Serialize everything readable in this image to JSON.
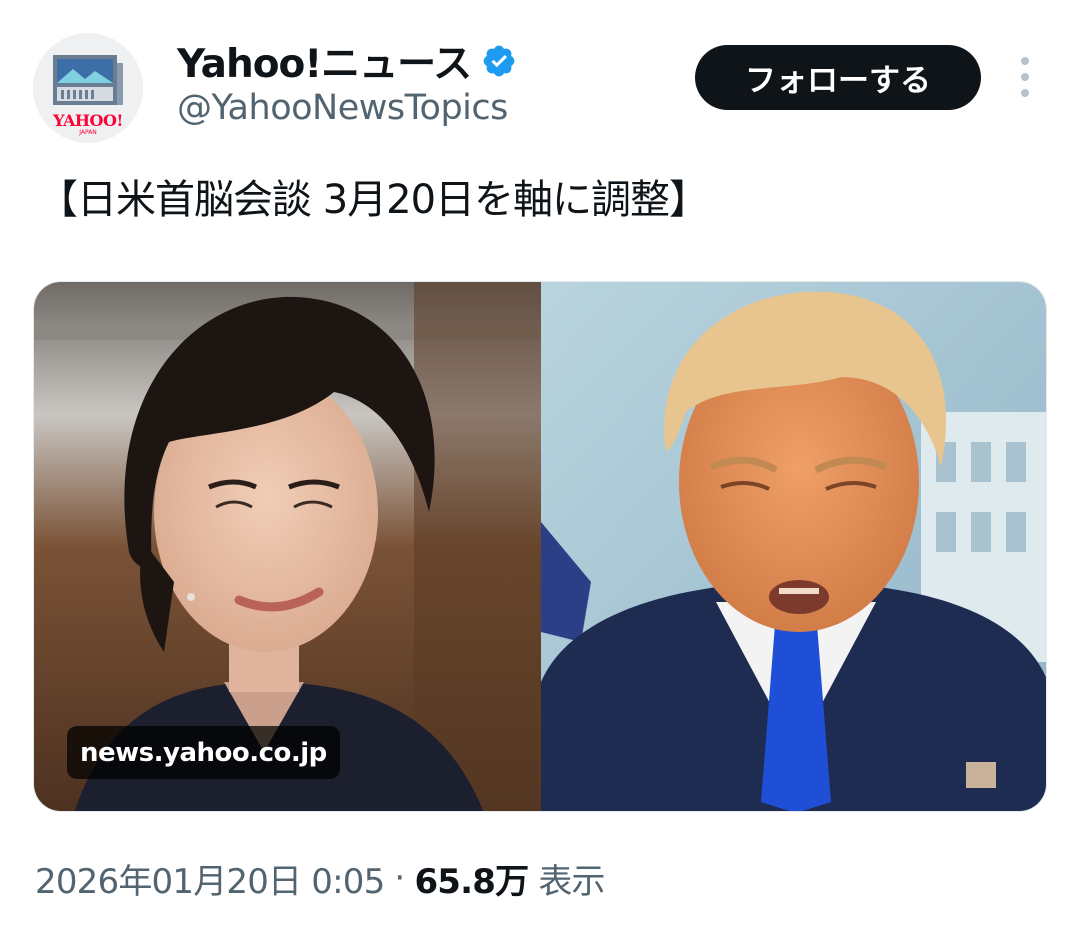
{
  "author": {
    "avatar_icon": "yahoo-news-logo-icon",
    "avatar_logo_text": "YAHOO!",
    "avatar_logo_sub": "JAPAN",
    "name": "Yahoo!ニュース",
    "verified_icon": "verified-badge-icon",
    "verified_color": "#1d9bf0",
    "handle": "@YahooNewsTopics"
  },
  "actions": {
    "follow_label": "フォローする",
    "more_icon": "more-vertical-icon"
  },
  "tweet": {
    "text": "【日米首脳会談 3月20日を軸に調整】"
  },
  "media": {
    "photos": [
      "portrait-photo-left",
      "portrait-photo-right"
    ],
    "source_label": "news.yahoo.co.jp"
  },
  "meta": {
    "timestamp": "2026年01月20日 0:05",
    "separator": "·",
    "views_count": "65.8万",
    "views_label": "表示"
  },
  "colors": {
    "text_primary": "#0f1419",
    "text_secondary": "#536471",
    "button_bg": "#0f1419",
    "brand_red": "#ff0033"
  }
}
